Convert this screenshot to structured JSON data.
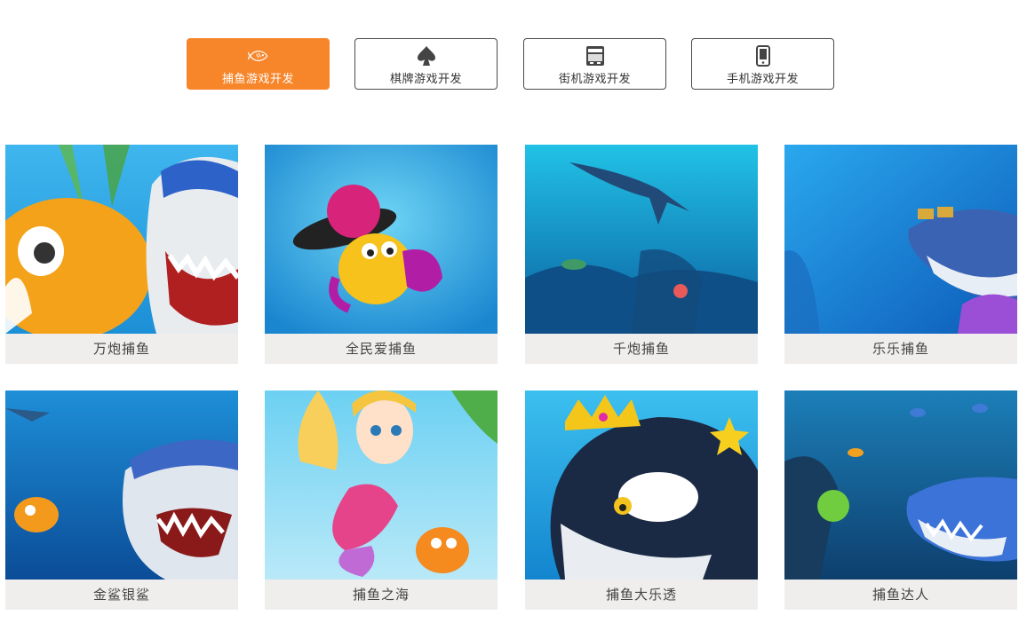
{
  "tabs": [
    {
      "label": "捕鱼游戏开发",
      "icon": "fish-icon",
      "active": true
    },
    {
      "label": "棋牌游戏开发",
      "icon": "spade-icon",
      "active": false
    },
    {
      "label": "街机游戏开发",
      "icon": "arcade-machine-icon",
      "active": false
    },
    {
      "label": "手机游戏开发",
      "icon": "mobile-phone-icon",
      "active": false
    }
  ],
  "games": [
    {
      "title": "万炮捕鱼"
    },
    {
      "title": "全民爱捕鱼"
    },
    {
      "title": "千炮捕鱼"
    },
    {
      "title": "乐乐捕鱼"
    },
    {
      "title": "金鲨银鲨"
    },
    {
      "title": "捕鱼之海"
    },
    {
      "title": "捕鱼大乐透"
    },
    {
      "title": "捕鱼达人"
    }
  ],
  "colors": {
    "accent": "#f7852a",
    "caption_bg": "#f0eeed"
  }
}
